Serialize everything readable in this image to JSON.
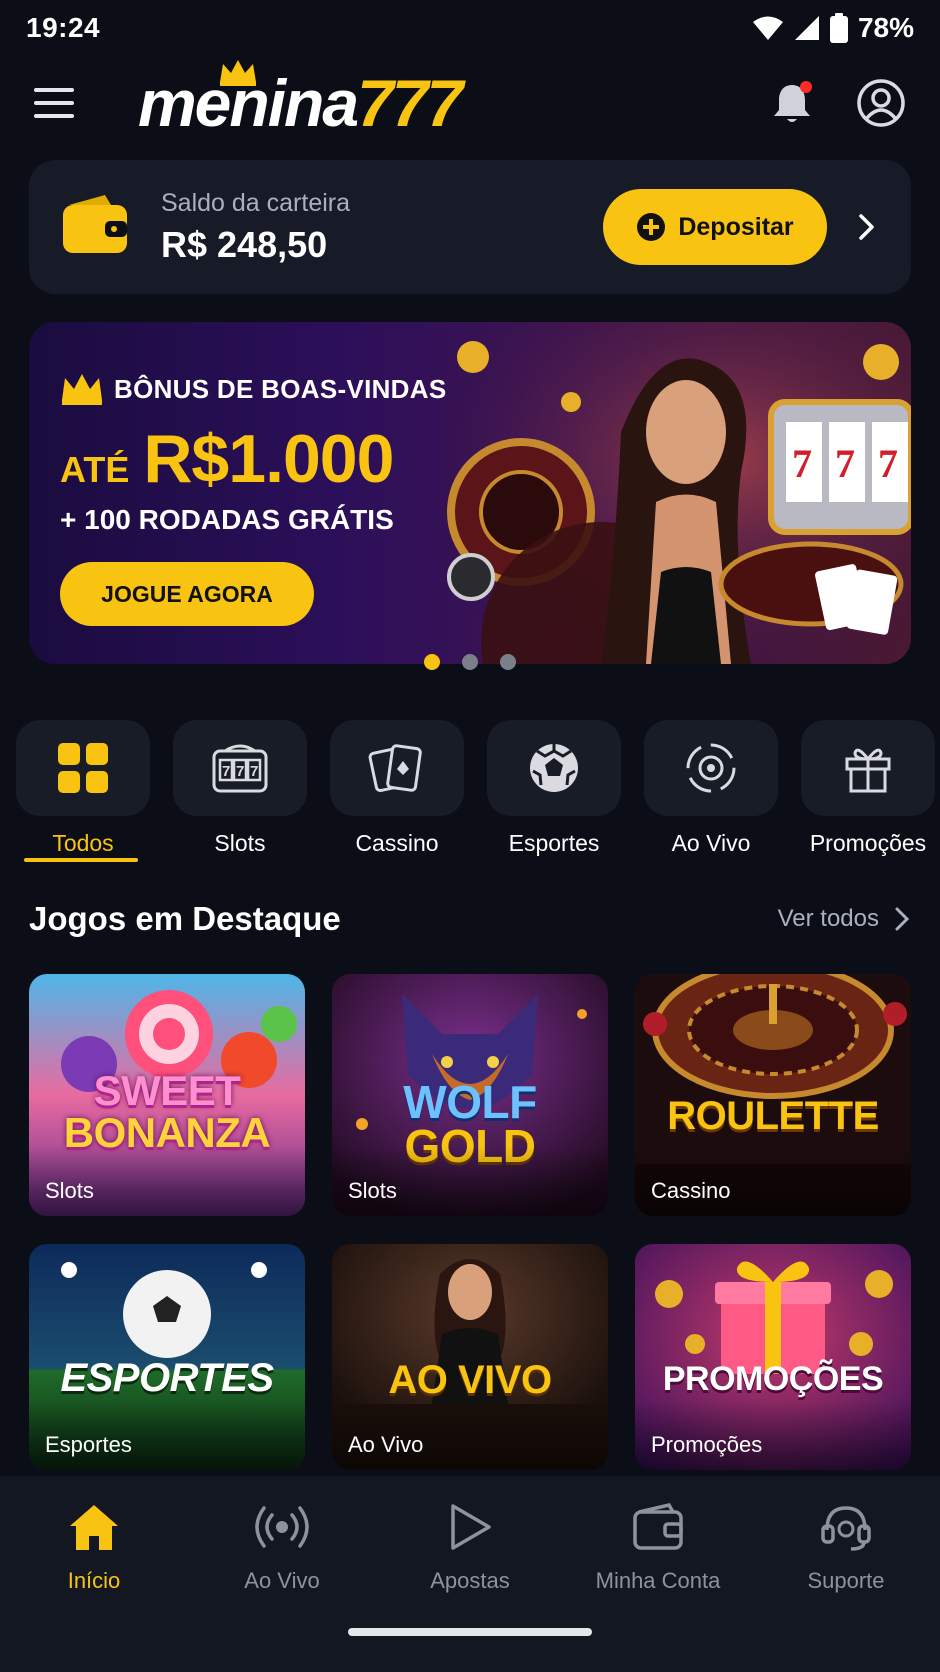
{
  "status_bar": {
    "time": "19:24",
    "battery": "78%"
  },
  "header": {
    "logo_part1": "menina",
    "logo_part2": "777"
  },
  "wallet": {
    "label": "Saldo da carteira",
    "balance": "R$ 248,50",
    "deposit_label": "Depositar"
  },
  "banner": {
    "bonus_title": "BÔNUS DE BOAS-VINDAS",
    "amount_prefix": "ATÉ",
    "amount": "R$1.000",
    "spins": "+ 100 RODADAS GRÁTIS",
    "cta": "JOGUE AGORA",
    "slide_count": 3,
    "active_slide": 1
  },
  "categories": [
    {
      "label": "Todos",
      "icon": "grid-icon",
      "active": true
    },
    {
      "label": "Slots",
      "icon": "slot-machine-icon",
      "active": false
    },
    {
      "label": "Cassino",
      "icon": "cards-icon",
      "active": false
    },
    {
      "label": "Esportes",
      "icon": "soccer-ball-icon",
      "active": false
    },
    {
      "label": "Ao Vivo",
      "icon": "live-icon",
      "active": false
    },
    {
      "label": "Promoções",
      "icon": "gift-icon",
      "active": false
    }
  ],
  "featured": {
    "title": "Jogos em Destaque",
    "see_all": "Ver todos",
    "games": [
      {
        "title_line1": "SWEET",
        "title_line2": "BONANZA",
        "category": "Slots"
      },
      {
        "title_line1": "WOLF",
        "title_line2": "GOLD",
        "category": "Slots"
      },
      {
        "title_line1": "ROULETTE",
        "category": "Cassino"
      },
      {
        "title_line1": "ESPORTES",
        "category": "Esportes"
      },
      {
        "title_line1": "AO VIVO",
        "category": "Ao Vivo"
      },
      {
        "title_line1": "PROMOÇÕES",
        "category": "Promoções"
      }
    ]
  },
  "bottom_nav": [
    {
      "label": "Início",
      "icon": "home-icon",
      "active": true
    },
    {
      "label": "Ao Vivo",
      "icon": "broadcast-icon",
      "active": false
    },
    {
      "label": "Apostas",
      "icon": "play-icon",
      "active": false
    },
    {
      "label": "Minha Conta",
      "icon": "wallet-icon",
      "active": false
    },
    {
      "label": "Suporte",
      "icon": "headset-icon",
      "active": false
    }
  ],
  "colors": {
    "accent": "#f9c311",
    "background": "#0b0e17",
    "card": "#161b27",
    "notification": "#ff2a2a"
  }
}
